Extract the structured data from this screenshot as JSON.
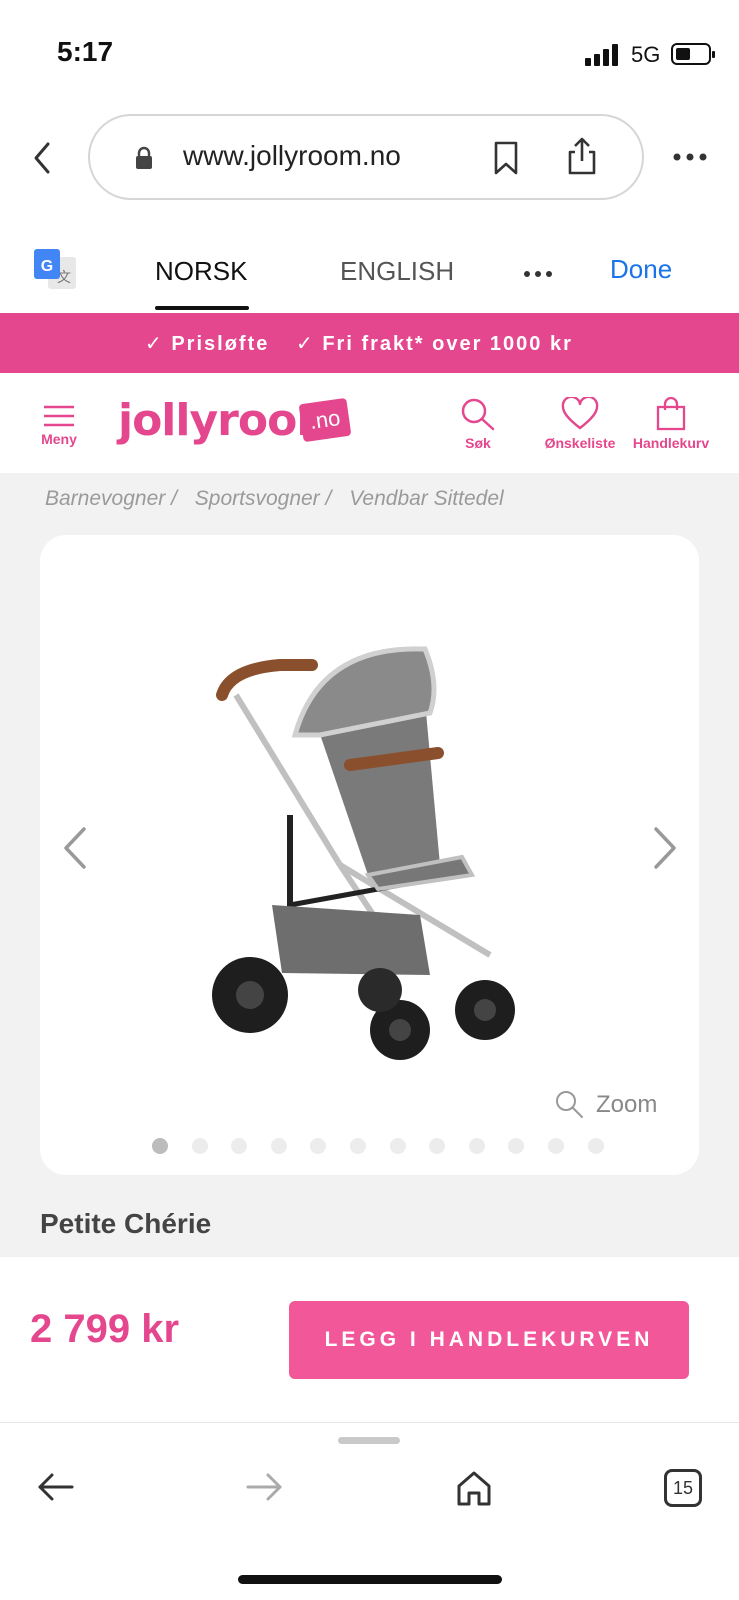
{
  "status_bar": {
    "time": "5:17",
    "network": "5G"
  },
  "browser": {
    "url": "www.jollyroom.no",
    "tab_count": "15"
  },
  "translate_bar": {
    "languages": [
      "NORSK",
      "ENGLISH"
    ],
    "active_language": "NORSK",
    "done_label": "Done"
  },
  "promo": {
    "items": [
      "Prisløfte",
      "Fri frakt* over 1000 kr"
    ]
  },
  "site_header": {
    "logo_text": "jollyroom",
    "logo_badge": ".no",
    "menu_label": "Meny",
    "search_label": "Søk",
    "wishlist_label": "Ønskeliste",
    "cart_label": "Handlekurv"
  },
  "breadcrumb": [
    "Barnevogner /",
    "Sportsvogner /",
    "Vendbar Sittedel"
  ],
  "gallery": {
    "zoom_label": "Zoom",
    "image_count": 12,
    "active_index": 0
  },
  "product": {
    "title": "Petite Chérie",
    "price": "2 799 kr",
    "add_to_cart_label": "LEGG I HANDLEKURVEN"
  },
  "colors": {
    "brand_pink": "#e4478e",
    "button_pink": "#f25799",
    "link_blue": "#1a73e8"
  }
}
